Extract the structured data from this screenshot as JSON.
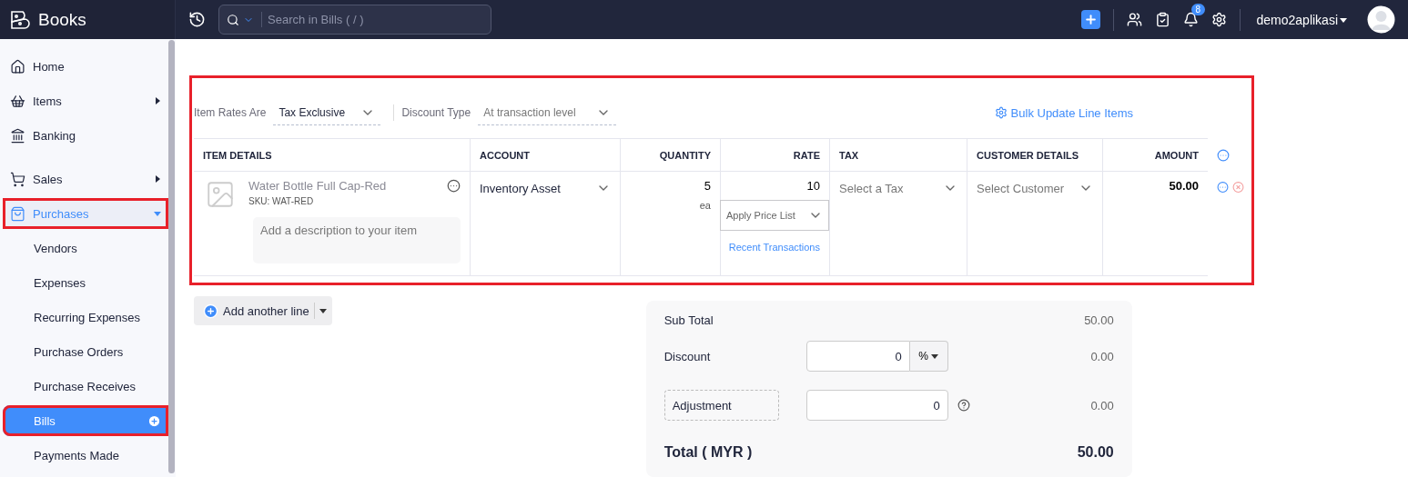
{
  "topbar": {
    "logo": "Books",
    "search": {
      "placeholder": "Search in Bills ( / )"
    },
    "notifications": "8",
    "user": "demo2aplikasi"
  },
  "sidebar": {
    "items": [
      {
        "label": "Home",
        "selected": false,
        "highlighted": false
      },
      {
        "label": "Items",
        "selected": false,
        "expanded": false,
        "highlighted": false
      },
      {
        "label": "Banking",
        "selected": false,
        "highlighted": false
      },
      {
        "label": "Sales",
        "selected": false,
        "expanded": false,
        "highlighted": false
      },
      {
        "label": "Purchases",
        "selected": false,
        "expanded": true,
        "highlighted": true,
        "children": [
          {
            "label": "Vendors",
            "selected": false,
            "highlighted": false
          },
          {
            "label": "Expenses",
            "selected": false,
            "highlighted": false
          },
          {
            "label": "Recurring Expenses",
            "selected": false,
            "highlighted": false
          },
          {
            "label": "Purchase Orders",
            "selected": false,
            "highlighted": false
          },
          {
            "label": "Purchase Receives",
            "selected": false,
            "highlighted": false
          },
          {
            "label": "Bills",
            "selected": true,
            "highlighted": true
          },
          {
            "label": "Payments Made",
            "selected": false,
            "highlighted": false
          }
        ]
      }
    ]
  },
  "line_items": {
    "highlighted": true,
    "item_rates": {
      "label": "Item Rates Are",
      "value": "Tax Exclusive"
    },
    "discount_type": {
      "label": "Discount Type",
      "placeholder": "At transaction level"
    },
    "bulk_update": "Bulk Update Line Items",
    "columns": [
      {
        "label": "ITEM DETAILS",
        "kind": "text"
      },
      {
        "label": "ACCOUNT",
        "kind": "text"
      },
      {
        "label": "QUANTITY",
        "kind": "number"
      },
      {
        "label": "RATE",
        "kind": "number"
      },
      {
        "label": "TAX",
        "kind": "text"
      },
      {
        "label": "CUSTOMER DETAILS",
        "kind": "text"
      },
      {
        "label": "AMOUNT",
        "kind": "number"
      }
    ],
    "rows": [
      {
        "item": "Water Bottle Full Cap-Red",
        "sku": "SKU: WAT-RED",
        "description_placeholder": "Add a description to your item",
        "account": "Inventory Asset",
        "quantity": "5",
        "unit": "ea",
        "rate": "10",
        "price_list_placeholder": "Apply Price List",
        "recent_link": "Recent Transactions",
        "tax_placeholder": "Select a Tax",
        "customer_placeholder": "Select Customer",
        "amount": "50.00"
      }
    ]
  },
  "add_line": "Add another line",
  "totals": {
    "sub_total": {
      "label": "Sub Total",
      "value": "50.00"
    },
    "discount": {
      "label": "Discount",
      "input": "0",
      "unit": "%",
      "value": "0.00"
    },
    "adjustment": {
      "label": "Adjustment",
      "input": "0",
      "value": "0.00"
    },
    "total": {
      "label": "Total ( MYR )",
      "value": "50.00"
    }
  }
}
